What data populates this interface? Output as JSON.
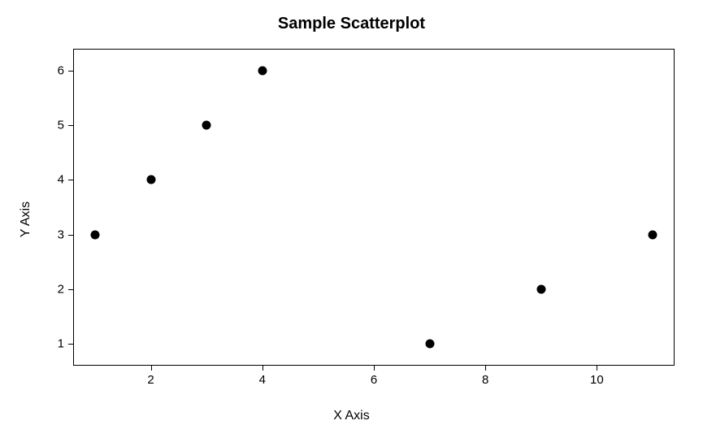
{
  "chart_data": {
    "type": "scatter",
    "title": "Sample Scatterplot",
    "xlabel": "X Axis",
    "ylabel": "Y Axis",
    "xlim": [
      1,
      11
    ],
    "ylim": [
      1,
      6
    ],
    "x_ticks": [
      2,
      4,
      6,
      8,
      10
    ],
    "y_ticks": [
      1,
      2,
      3,
      4,
      5,
      6
    ],
    "points": [
      {
        "x": 1,
        "y": 3
      },
      {
        "x": 2,
        "y": 4
      },
      {
        "x": 3,
        "y": 5
      },
      {
        "x": 4,
        "y": 6
      },
      {
        "x": 7,
        "y": 1
      },
      {
        "x": 9,
        "y": 2
      },
      {
        "x": 11,
        "y": 3
      }
    ]
  }
}
